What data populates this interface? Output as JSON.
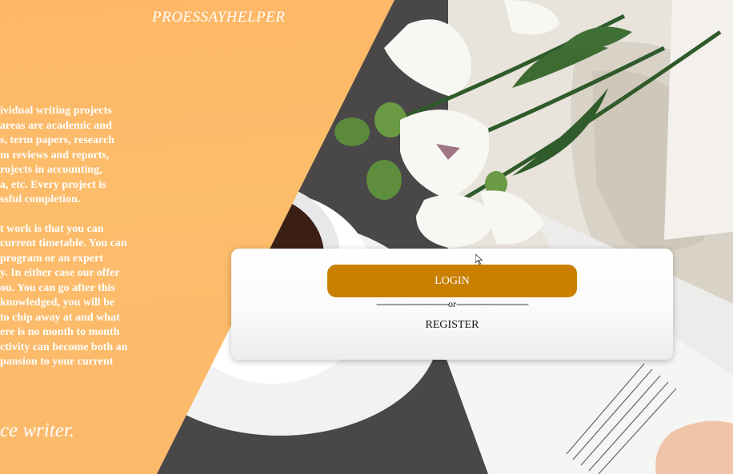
{
  "brand": "PROESSAYHELPER",
  "about": {
    "paragraph1": [
      "ividual writing projects",
      " areas are academic and",
      "s, term papers, research",
      "m reviews and reports,",
      "rojects in accounting,",
      "a, etc. Every project is",
      "ssful completion."
    ],
    "paragraph2": [
      "t work is that you can",
      "current timetable. You can",
      " program or an expert",
      "y. In either case our offer",
      "ou. You can go after this",
      "knowledged, you will be",
      "to chip away at and what",
      "ere is no month to month",
      "ctivity can become both an",
      "pansion to your current"
    ]
  },
  "tagline": "ce writer.",
  "auth": {
    "login_label": "LOGIN",
    "divider_left": "------------------------------",
    "divider_or": "or",
    "divider_right": "------------------------------",
    "register_label": "REGISTER"
  },
  "colors": {
    "accent": "#c98000",
    "panel": "#fdb767"
  }
}
